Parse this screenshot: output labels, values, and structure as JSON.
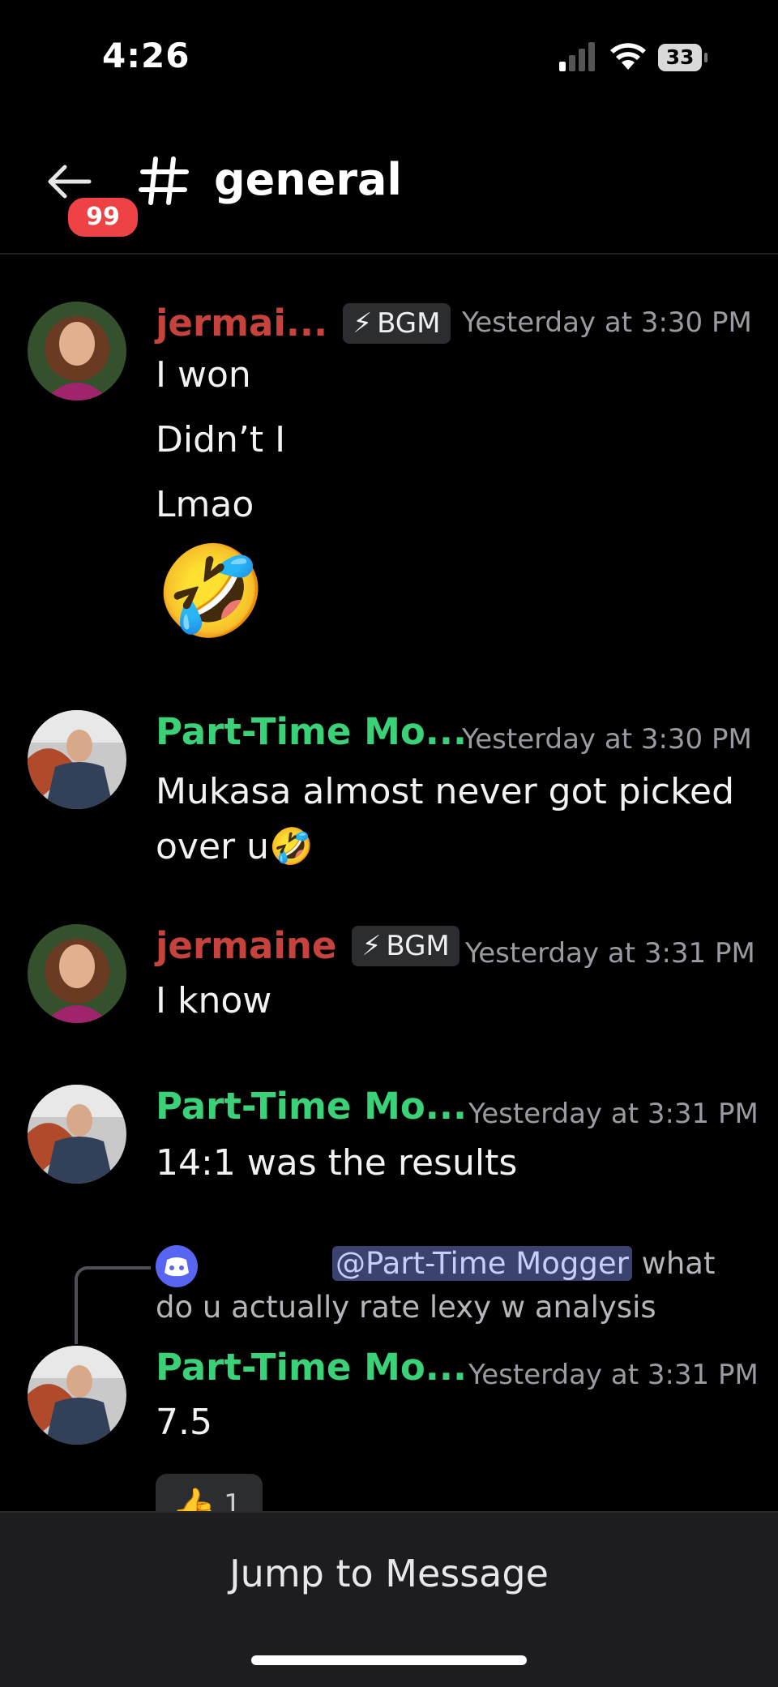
{
  "status_bar": {
    "time": "4:26",
    "battery": "33"
  },
  "header": {
    "unread_count": "99",
    "channel_name": "general"
  },
  "messages": [
    {
      "username": "jermai...",
      "role": "BGM",
      "timestamp": "Yesterday at 3:30 PM",
      "lines": [
        "I won",
        "Didn’t I",
        "Lmao"
      ],
      "emoji": "🤣"
    },
    {
      "username": "Part-Time Mo...",
      "timestamp": "Yesterday at 3:30 PM",
      "lines": [
        "Mukasa almost never got picked",
        "over u🤣"
      ]
    },
    {
      "username": "jermaine",
      "role": "BGM",
      "timestamp": "Yesterday at 3:31 PM",
      "lines": [
        "I know"
      ]
    },
    {
      "username": "Part-Time Mo...",
      "timestamp": "Yesterday at 3:31 PM",
      "lines": [
        "14:1 was the results"
      ]
    },
    {
      "reply": {
        "mention": "@Part-Time Mogger",
        "text_after": " what",
        "line2": "do u actually rate lexy w analysis"
      },
      "username": "Part-Time Mo...",
      "timestamp": "Yesterday at 3:31 PM",
      "lines": [
        "7.5"
      ],
      "reaction": {
        "emoji": "👍",
        "count": "1"
      }
    }
  ],
  "footer": {
    "jump_label": "Jump to Message"
  },
  "colors": {
    "red_user": "#c6423c",
    "green_user": "#3ad178",
    "badge": "#ee4245",
    "mention_bg": "#3c4270"
  }
}
